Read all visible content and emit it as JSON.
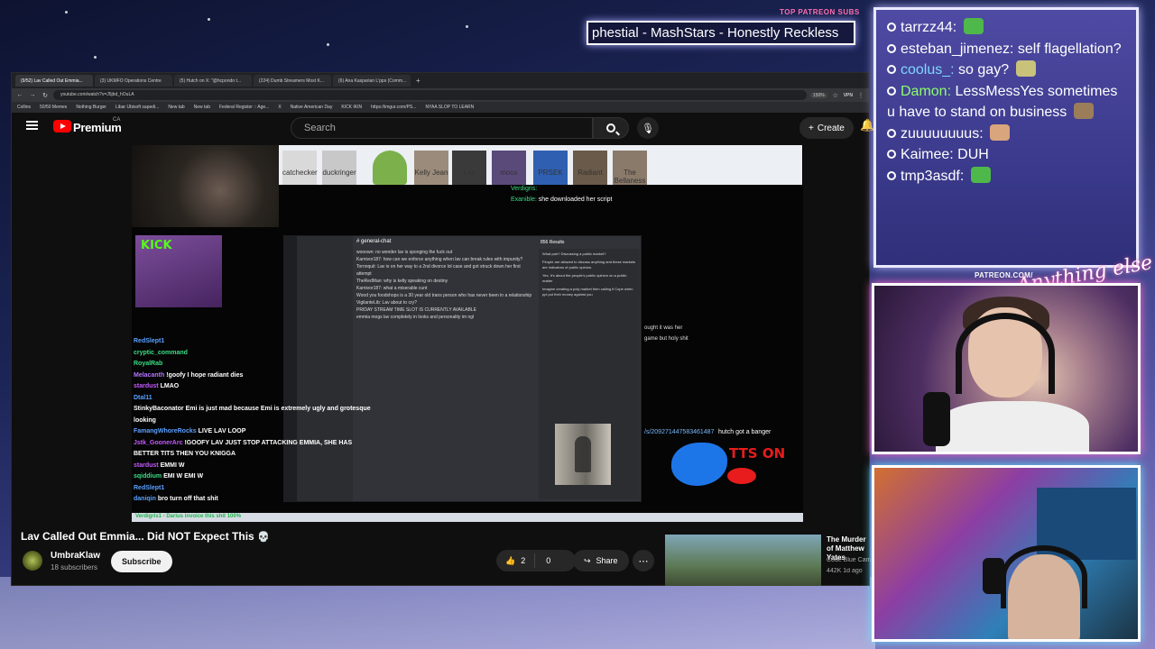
{
  "overlay": {
    "patreon_label": "TOP PATREON SUBS",
    "ticker_text": "phestial - MashStars - Honestly Reckless",
    "patreon_url": "PATREON.COM/",
    "anything_else_logo": "Anything else"
  },
  "browser": {
    "tabs": [
      {
        "label": "(9/52) Lav Called Out Emmia...",
        "active": true
      },
      {
        "label": "(3) UKMFO Operations Centre",
        "active": false
      },
      {
        "label": "(5) Hutch on X: \"@hcpondo t...",
        "active": false
      },
      {
        "label": "(224) Dumb Streamers Most K...",
        "active": false
      },
      {
        "label": "(6) Ana Kasparian L'pps (Comm...",
        "active": false
      }
    ],
    "url": "youtube.com/watch?v=J5jbd_hOuLA",
    "zoom": "150%",
    "vpn": "VPN",
    "bookmarks": [
      "Collins",
      "50/50 Memes",
      "Nothing Burger",
      "Libar Ubisoft sapedi...",
      "New tab",
      "New tab",
      "Federal Register :: Age...",
      "X",
      "Native American Day",
      "KICK IKIN",
      "https://imgur.com/PS...",
      "NYAA SLOP TO LEARN"
    ]
  },
  "youtube": {
    "brand": "Premium",
    "region": "CA",
    "search_placeholder": "Search",
    "create_label": "Create",
    "video": {
      "title": "Lav Called Out Emmia... Did NOT Expect This",
      "channel": "UmbraKlaw",
      "subscribers": "18 subscribers",
      "subscribe_label": "Subscribe",
      "likes": "2",
      "dislikes": "0",
      "share_label": "Share"
    },
    "suggested": {
      "title": "The Murder of Matthew Yates",
      "channel": "Code Blue Cam",
      "meta": "442K  1d ago"
    }
  },
  "video_content": {
    "kick_logo": "KICK",
    "discord": {
      "channel_title": "# general-chat",
      "results_label": "856 Results",
      "messages": [
        "wooown: no wonder lav is sponging the fuck out",
        "Karnivor187: how can we enforce anything when lav can break rules with impunity?",
        "Tornnquit: Lav is on her way to a 2nd divorce lol case and got struck down her first attempt",
        "TheRedMan: why is kelly speaking on destiny",
        "Karnivor187: what a miserable cunt",
        "Wood you foodshops is a 30 year old trans person who has never been in a relationship",
        "VigilanteLib: Lav about to cry?",
        "PRIDAY STREAM TIME SLOT IS CURRENTLY AVAILABLE",
        "emmia mogs lav completely in looks and personality im ngl"
      ],
      "search_results": [
        "What part? Discussing a public market?",
        "People are allowed to discuss anything and these markets are indicators of public opinion.",
        "Yes. It's about the people's public opinion on a public matter",
        "Imagine creating a poly market then calling it Cope when ppl put their money against you"
      ]
    },
    "overlay_chat": [
      {
        "name": "RedSlept1",
        "color": "#5aa0ff",
        "text": ""
      },
      {
        "name": "cryptic_command",
        "color": "#3ddc84",
        "text": ""
      },
      {
        "name": "RoyalRab",
        "color": "#3ddc84",
        "text": ""
      },
      {
        "name": "Melacanth",
        "color": "#b575ff",
        "text": "!goofy I hope radiant dies"
      },
      {
        "name": "stardust",
        "color": "#c45aff",
        "text": "LMAO"
      },
      {
        "name": "Dtal11",
        "color": "#5aa0ff",
        "text": ""
      },
      {
        "name": "StinkyBaconator",
        "color": "#ffffff",
        "text": "Emi is just mad because Emi is extremely ugly and grotesque looking"
      },
      {
        "name": "FamangWhoreRocks",
        "color": "#5aa0ff",
        "text": "LIVE LAV LOOP"
      },
      {
        "name": "Jstk_GoonerArc",
        "color": "#c45aff",
        "text": "!GOOFY LAV JUST STOP ATTACKING EMMIA, SHE HAS BETTER TITS THEN YOU KNIGGA"
      },
      {
        "name": "stardust",
        "color": "#c45aff",
        "text": "EMMI W"
      },
      {
        "name": "sqiddium",
        "color": "#3ddc84",
        "text": "EMI W EMI W"
      },
      {
        "name": "RedSlept1",
        "color": "#5aa0ff",
        "text": ""
      },
      {
        "name": "daniqin",
        "color": "#5aa0ff",
        "text": "bro turn off that shit"
      }
    ],
    "right_chat": [
      {
        "name": "Verdigris:",
        "text": ""
      },
      {
        "name": "Exanible:",
        "text": "she downloaded her script"
      }
    ],
    "side_text_1": "ought it was her",
    "side_text_2": "game but holy shit",
    "url_line": "/s/209271447583461487",
    "hutch_text": "hutch got a banger",
    "tts_label": "TTS ON",
    "taskbar_text": "Verdigris1 - Darius invoice this shit 100%",
    "emotes": [
      "catchecker",
      "duckringer",
      "",
      "Kelly Jean",
      "Lav",
      "moox",
      "PRSEK",
      "Radiant",
      "The Bellaness"
    ]
  },
  "stream_chat": [
    {
      "user": "tarrzz44:",
      "text": "",
      "user_color": "#ffffff",
      "emote_color": "#4fb84a"
    },
    {
      "user": "esteban_jimenez:",
      "text": "self flagellation?",
      "user_color": "#ffffff",
      "emote_color": ""
    },
    {
      "user": "coolus_:",
      "text": "so gay?",
      "user_color": "#7fd8ff",
      "emote_color": "#c9c27a"
    },
    {
      "user": "Damon:",
      "text": "LessMessYes sometimes u have to stand on business",
      "user_color": "#8cff6a",
      "emote_color": "#9b7d5a"
    },
    {
      "user": "zuuuuuuuus:",
      "text": "",
      "user_color": "#ffffff",
      "emote_color": "#d9a57c"
    },
    {
      "user": "Kaimee:",
      "text": "DUH",
      "user_color": "#ffffff",
      "emote_color": ""
    },
    {
      "user": "tmp3asdf:",
      "text": "",
      "user_color": "#ffffff",
      "emote_color": "#4fb84a"
    }
  ]
}
